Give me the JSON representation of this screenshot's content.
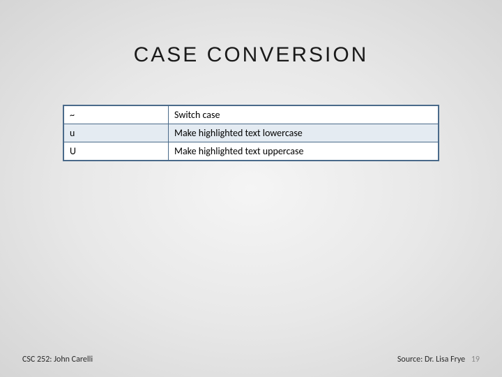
{
  "title": "CASE CONVERSION",
  "rows": [
    {
      "key": "~",
      "desc": "Switch case"
    },
    {
      "key": "u",
      "desc": "Make highlighted text lowercase"
    },
    {
      "key": "U",
      "desc": "Make highlighted text uppercase"
    }
  ],
  "footer": {
    "left": "CSC 252: John Carelli",
    "source": "Source: Dr. Lisa Frye",
    "page": "19"
  }
}
